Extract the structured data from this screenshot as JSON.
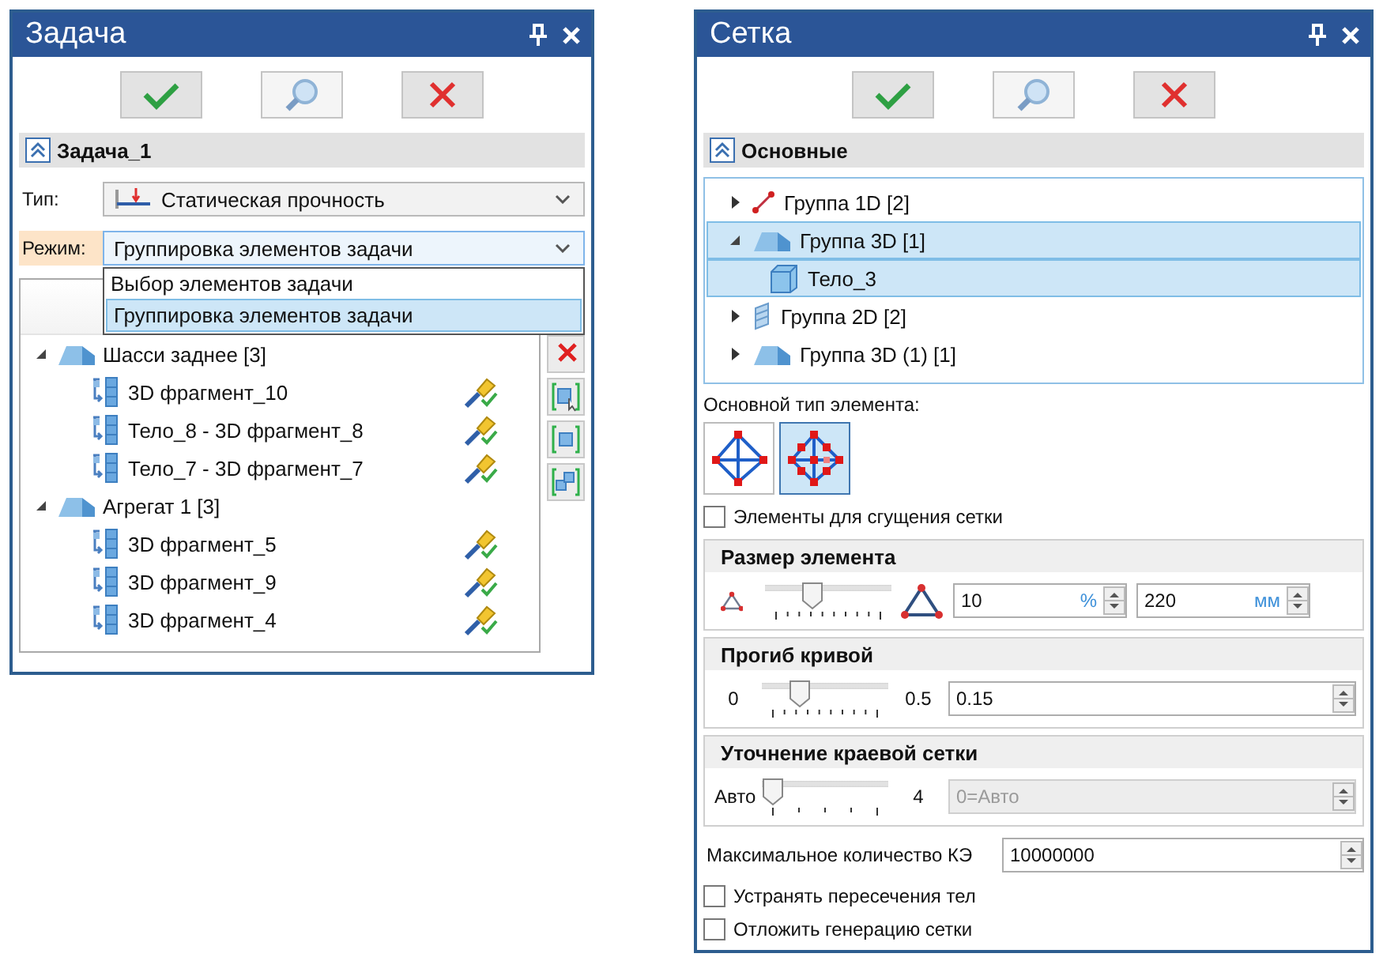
{
  "task_panel": {
    "title": "Задача",
    "section": {
      "title": "Задача_1",
      "expanded": true
    },
    "type_field": {
      "label": "Тип:",
      "value": "Статическая прочность"
    },
    "mode_field": {
      "label": "Режим:",
      "value": "Группировка элементов задачи",
      "expanded": true,
      "options": [
        {
          "label": "Выбор элементов задачи",
          "selected": false
        },
        {
          "label": "Группировка элементов задачи",
          "selected": true
        }
      ]
    },
    "tree": [
      {
        "label": "Шасси заднее [3]",
        "expanded": true,
        "children": [
          {
            "label": "3D фрагмент_10"
          },
          {
            "label": "Тело_8 - 3D фрагмент_8"
          },
          {
            "label": "Тело_7 - 3D фрагмент_7"
          }
        ]
      },
      {
        "label": "Агрегат 1 [3]",
        "expanded": true,
        "children": [
          {
            "label": "3D фрагмент_5"
          },
          {
            "label": "3D фрагмент_9"
          },
          {
            "label": "3D фрагмент_4"
          }
        ]
      }
    ]
  },
  "mesh_panel": {
    "title": "Сетка",
    "section": {
      "title": "Основные",
      "expanded": true
    },
    "tree": [
      {
        "kind": "line",
        "label": "Группа 1D [2]",
        "expanded": false,
        "selected": false
      },
      {
        "kind": "solid",
        "label": "Группа 3D [1]",
        "expanded": true,
        "selected": true,
        "children": [
          {
            "kind": "body",
            "label": "Тело_3",
            "selected": true
          }
        ]
      },
      {
        "kind": "shell",
        "label": "Группа 2D [2]",
        "expanded": false,
        "selected": false
      },
      {
        "kind": "solid",
        "label": "Группа 3D (1) [1]",
        "expanded": false,
        "selected": false
      }
    ],
    "element_type": {
      "label": "Основной тип элемента:",
      "options": [
        {
          "kind": "linear",
          "selected": false
        },
        {
          "kind": "quadratic",
          "selected": true
        }
      ]
    },
    "refine_checkbox": {
      "label": "Элементы для сгущения сетки",
      "checked": false
    },
    "element_size": {
      "title": "Размер элемента",
      "level": 0.35,
      "fields": [
        {
          "value": "10",
          "unit": "%"
        },
        {
          "value": "220",
          "unit": "мм"
        }
      ]
    },
    "curve_deflection": {
      "title": "Прогиб кривой",
      "min": "0",
      "max": "0.5",
      "level": 0.25,
      "value": "0.15"
    },
    "edge_refinement": {
      "title": "Уточнение краевой сетки",
      "min": "Авто",
      "max": "4",
      "level": 0,
      "placeholder": "0=Авто",
      "disabled": true
    },
    "max_elements": {
      "label": "Максимальное количество КЭ",
      "value": "10000000"
    },
    "options": [
      {
        "label": "Устранять пересечения тел",
        "checked": false
      },
      {
        "label": "Отложить генерацию сетки",
        "checked": false
      }
    ]
  }
}
